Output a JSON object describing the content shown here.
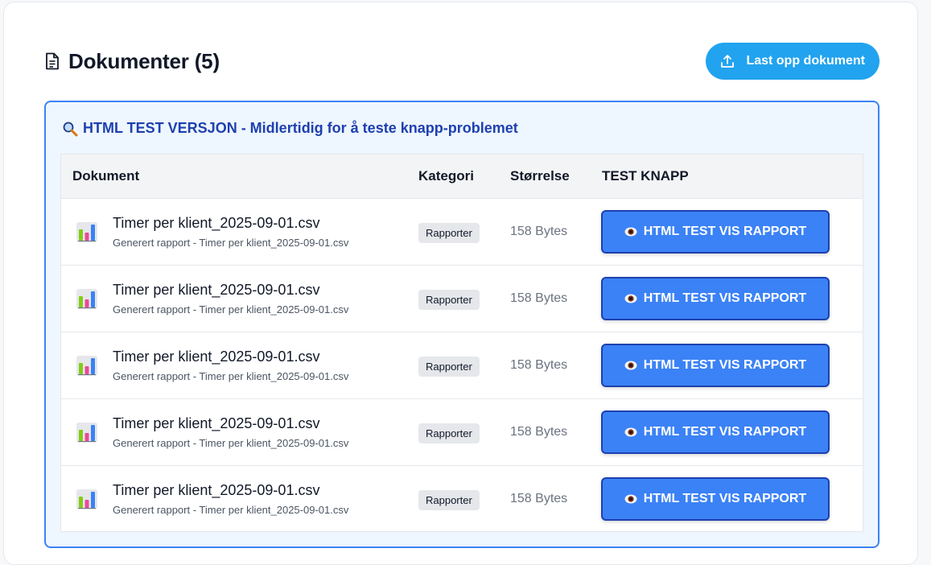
{
  "header": {
    "title": "Dokumenter (5)",
    "upload_label": "Last opp dokument"
  },
  "test_section": {
    "heading": "HTML TEST VERSJON - Midlertidig for å teste knapp-problemet"
  },
  "table": {
    "columns": [
      "Dokument",
      "Kategori",
      "Størrelse",
      "TEST KNAPP"
    ],
    "rows": [
      {
        "name": "Timer per klient_2025-09-01.csv",
        "description": "Generert rapport - Timer per klient_2025-09-01.csv",
        "category": "Rapporter",
        "size": "158 Bytes",
        "button": "HTML TEST VIS RAPPORT"
      },
      {
        "name": "Timer per klient_2025-09-01.csv",
        "description": "Generert rapport - Timer per klient_2025-09-01.csv",
        "category": "Rapporter",
        "size": "158 Bytes",
        "button": "HTML TEST VIS RAPPORT"
      },
      {
        "name": "Timer per klient_2025-09-01.csv",
        "description": "Generert rapport - Timer per klient_2025-09-01.csv",
        "category": "Rapporter",
        "size": "158 Bytes",
        "button": "HTML TEST VIS RAPPORT"
      },
      {
        "name": "Timer per klient_2025-09-01.csv",
        "description": "Generert rapport - Timer per klient_2025-09-01.csv",
        "category": "Rapporter",
        "size": "158 Bytes",
        "button": "HTML TEST VIS RAPPORT"
      },
      {
        "name": "Timer per klient_2025-09-01.csv",
        "description": "Generert rapport - Timer per klient_2025-09-01.csv",
        "category": "Rapporter",
        "size": "158 Bytes",
        "button": "HTML TEST VIS RAPPORT"
      }
    ]
  },
  "icons": {
    "title_icon": "document-icon",
    "upload_icon": "upload-icon",
    "heading_icon": "magnifier-icon",
    "row_icon": "bar-chart-icon",
    "button_icon": "eye-icon"
  },
  "colors": {
    "upload_button": "#21a3ef",
    "test_border": "#3b82f6",
    "test_heading": "#1e40af",
    "action_button": "#3b82f6"
  }
}
